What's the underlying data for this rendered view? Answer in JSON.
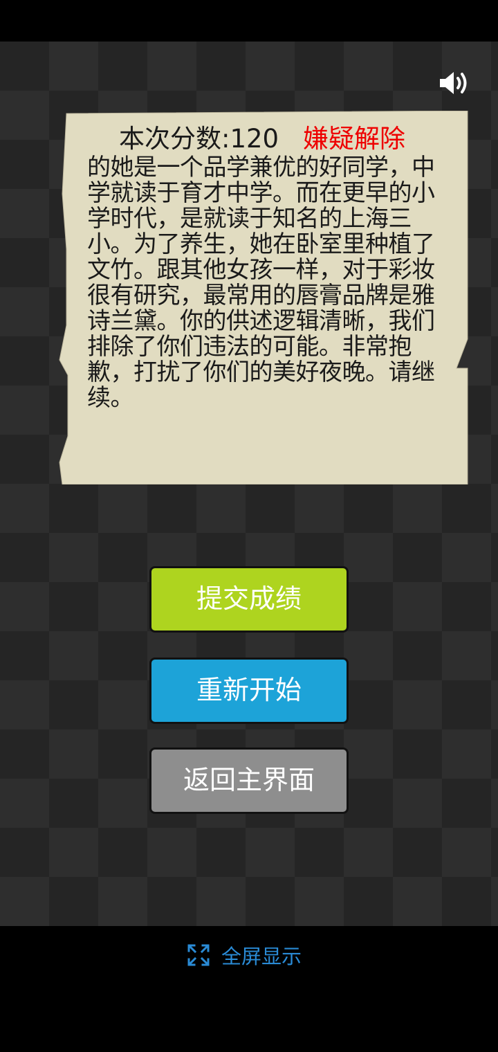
{
  "colors": {
    "paper": "#e1dcc1",
    "verdict": "#ee0000",
    "submit_button": "#aed41f",
    "restart_button": "#1da3d8",
    "home_button": "#8e8e8e",
    "fullscreen_link": "#2a8bd6"
  },
  "sound_button": {
    "icon": "speaker-icon"
  },
  "result_card": {
    "score_label": "本次分数:120",
    "verdict": "嫌疑解除",
    "story": "的她是一个品学兼优的好同学，中学就读于育才中学。而在更早的小学时代，是就读于知名的上海三小。为了养生，她在卧室里种植了文竹。跟其他女孩一样，对于彩妆很有研究，最常用的唇膏品牌是雅诗兰黛。你的供述逻辑清晰，我们排除了你们违法的可能。非常抱歉，打扰了你们的美好夜晚。请继续。"
  },
  "buttons": {
    "submit": "提交成绩",
    "restart": "重新开始",
    "home": "返回主界面"
  },
  "footer": {
    "fullscreen_icon": "expand-icon",
    "fullscreen_label": "全屏显示"
  }
}
